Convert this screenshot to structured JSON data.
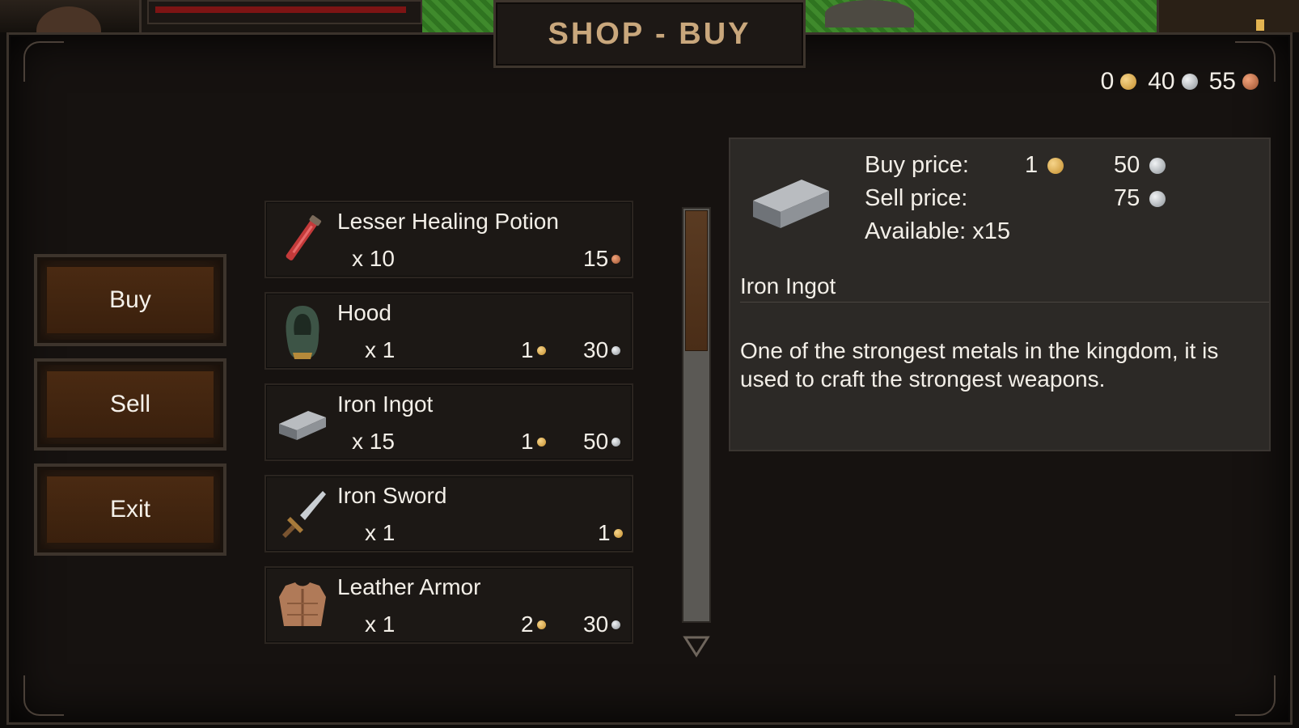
{
  "title": "SHOP - BUY",
  "currency": [
    {
      "value": "0",
      "coin": "gold"
    },
    {
      "value": "40",
      "coin": "silver"
    },
    {
      "value": "55",
      "coin": "copper"
    }
  ],
  "menu": {
    "buy": "Buy",
    "sell": "Sell",
    "exit": "Exit"
  },
  "items": [
    {
      "name": "Lesser Healing Potion",
      "qty": "x 10",
      "price_a": "",
      "price_b": "15",
      "icon": "potion-icon",
      "coin_b": "copper"
    },
    {
      "name": "Hood",
      "qty": "x 1",
      "price_a": "1",
      "price_b": "30",
      "icon": "hood-icon",
      "coin_a": "gold",
      "coin_b": "silver"
    },
    {
      "name": "Iron Ingot",
      "qty": "x 15",
      "price_a": "1",
      "price_b": "50",
      "icon": "ingot-icon",
      "coin_a": "gold",
      "coin_b": "silver"
    },
    {
      "name": "Iron Sword",
      "qty": "x 1",
      "price_a": "",
      "price_b": "1",
      "icon": "sword-icon",
      "coin_b": "gold"
    },
    {
      "name": "Leather Armor",
      "qty": "x 1",
      "price_a": "2",
      "price_b": "30",
      "icon": "armor-icon",
      "coin_a": "gold",
      "coin_b": "silver"
    }
  ],
  "scroll": {
    "position": 0
  },
  "detail": {
    "buy_label": "Buy price:",
    "buy_gold": "1",
    "buy_silver": "50",
    "sell_label": "Sell price:",
    "sell_silver": "75",
    "available": "Available: x15",
    "name": "Iron Ingot",
    "description": "One of the strongest metals in the kingdom, it is used to craft the strongest weapons."
  },
  "colors": {
    "gold": "#d9a74a",
    "silver": "#c4c8cc",
    "copper": "#c06e45",
    "button": "#3f240f",
    "title": "#c9a77c"
  }
}
